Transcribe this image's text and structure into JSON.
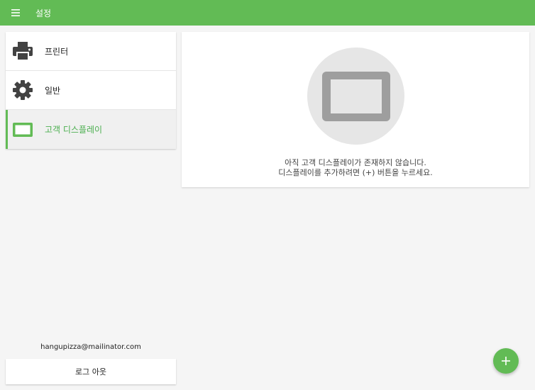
{
  "appbar": {
    "title": "설정",
    "menu_icon": "menu-icon",
    "color": "#62bb55"
  },
  "sidebar": {
    "items": [
      {
        "label": "프린터",
        "icon": "printer-icon",
        "active": false
      },
      {
        "label": "일반",
        "icon": "gear-icon",
        "active": false
      },
      {
        "label": "고객 디스플레이",
        "icon": "display-icon",
        "active": true
      }
    ],
    "accent_color": "#62bb55"
  },
  "account": {
    "email": "hangupizza@mailinator.com",
    "logout_label": "로그 아웃"
  },
  "empty_state": {
    "icon": "tablet-icon",
    "line1": "아직 고객 디스플레이가 존재하지 않습니다.",
    "line2": "디스플레이를 추가하려면 (+) 버튼을 누르세요."
  },
  "fab": {
    "icon": "plus-icon"
  }
}
